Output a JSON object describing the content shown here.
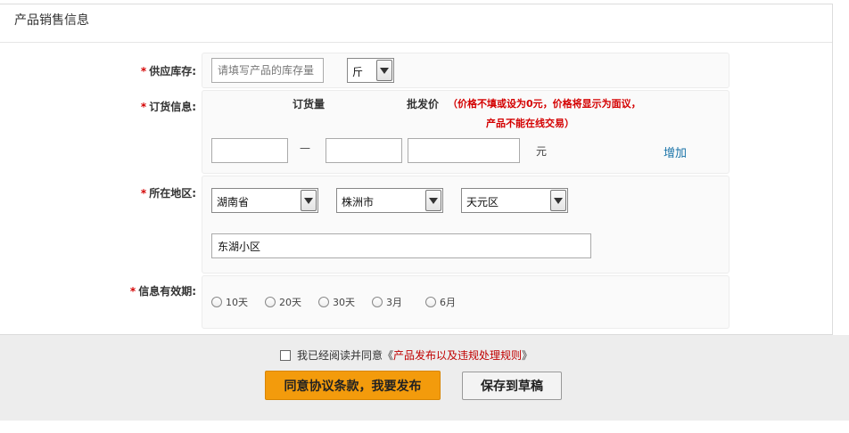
{
  "panel": {
    "title": "产品销售信息"
  },
  "stock": {
    "label": "供应库存:",
    "input_placeholder": "请填写产品的库存量",
    "unit_selected": "斤"
  },
  "order": {
    "label": "订货信息:",
    "qty_header": "订货量",
    "price_header": "批发价",
    "note_line1": "（价格不填或设为0元，价格将显示为面议，",
    "note_line2": "产品不能在线交易）",
    "dash": "—",
    "currency": "元",
    "add_link": "增加",
    "min_qty": "",
    "max_qty": "",
    "price": ""
  },
  "region": {
    "label": "所在地区:",
    "province": "湖南省",
    "city": "株洲市",
    "district": "天元区",
    "address": "东湖小区"
  },
  "validity": {
    "label": "信息有效期:",
    "options": [
      "10天",
      "20天",
      "30天",
      "3月",
      "6月"
    ]
  },
  "footer": {
    "agree_text": "我已经阅读并同意《",
    "agree_link": "产品发布以及违规处理规则",
    "agree_close": "》",
    "publish_button": "同意协议条款，我要发布",
    "draft_button": "保存到草稿"
  },
  "colors": {
    "required": "#d40000",
    "link": "#1a73a8",
    "primary_button": "#f39b0c"
  }
}
